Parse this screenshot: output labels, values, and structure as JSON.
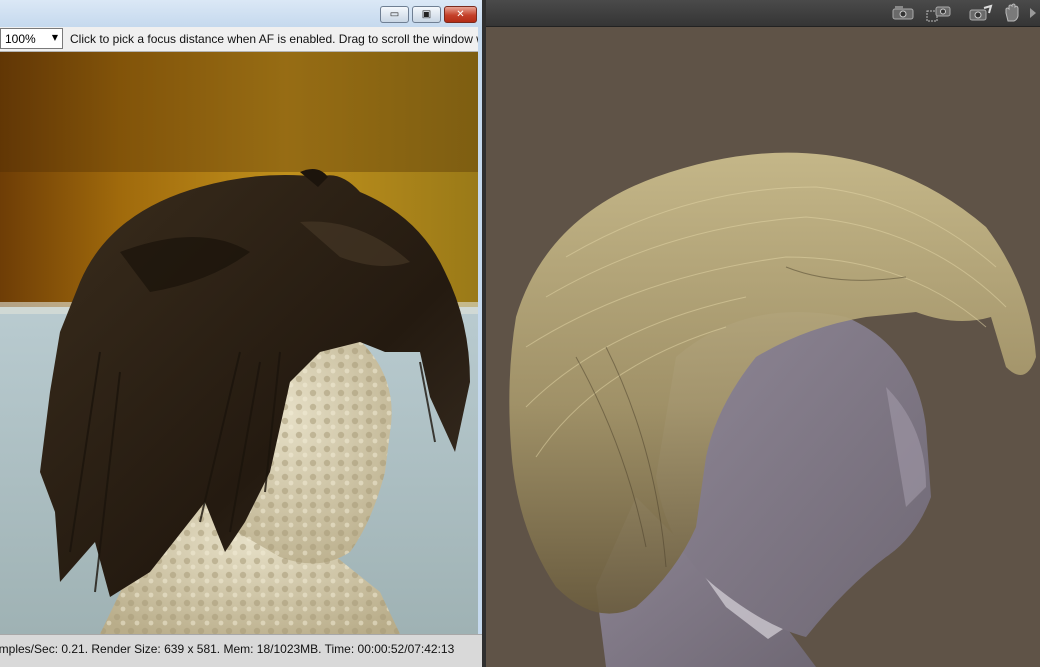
{
  "render_window": {
    "title_buttons": {
      "minimize": "▭",
      "maximize": "▣",
      "close": "✕"
    },
    "zoom": {
      "value": "100%"
    },
    "hint": "Click to pick a focus distance when AF is enabled.  Drag to scroll the window w",
    "status": "amples/Sec: 0.21. Render Size: 639 x 581. Mem: 18/1023MB. Time: 00:00:52/07:42:13"
  },
  "viewport": {
    "tools": [
      {
        "icon": "camera-orbit-icon"
      },
      {
        "icon": "camera-frame-icon"
      },
      {
        "icon": "camera-rotate-icon"
      },
      {
        "icon": "pan-hand-icon"
      },
      {
        "icon": "chevron-right-icon"
      }
    ]
  },
  "colors": {
    "render_bg_gold": "#b2810f",
    "render_bg_blue": "#a9bcc1",
    "viewport_bg": "#5b5045",
    "hair_dark": "#2c2115",
    "hair_blonde": "#b6a66f",
    "mannequin": "#8e8792"
  }
}
